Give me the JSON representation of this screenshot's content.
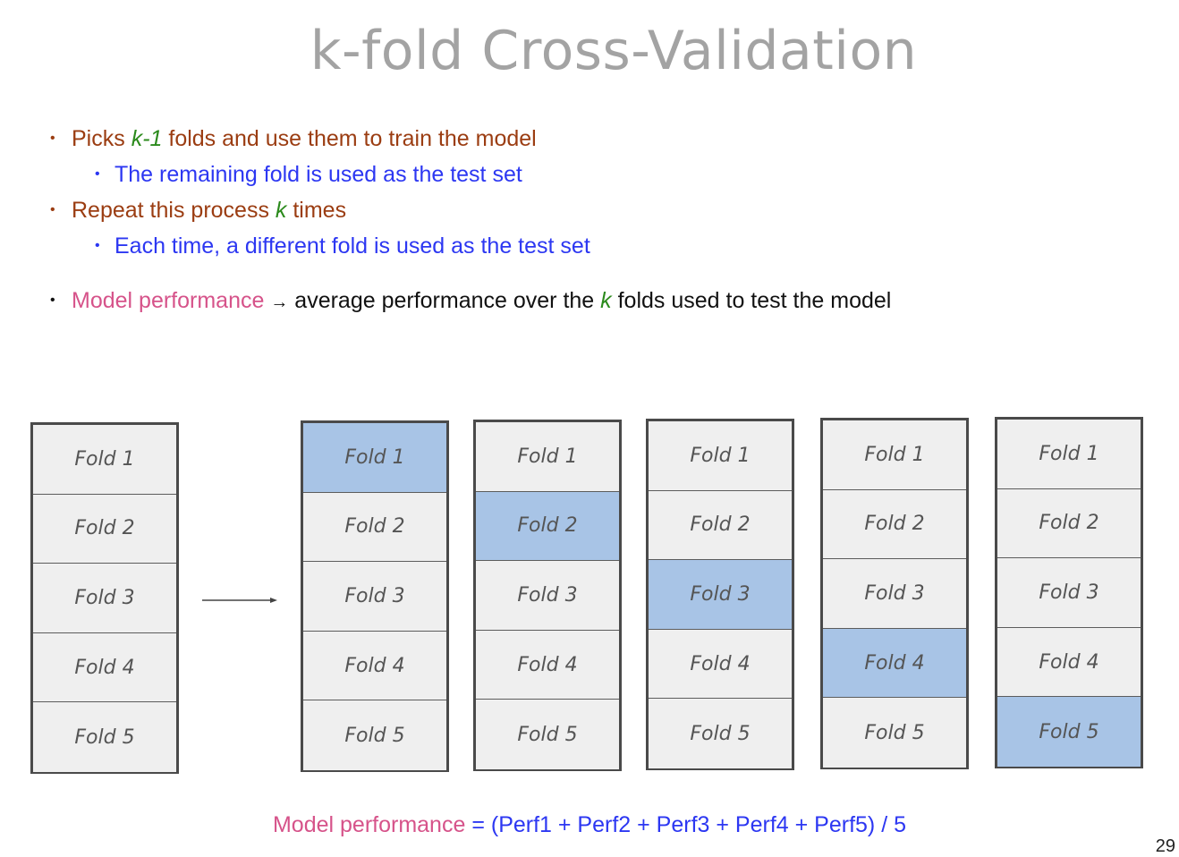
{
  "title": "k-fold Cross-Validation",
  "bullets": {
    "b1": {
      "pre": "Picks ",
      "k": "k-1",
      "post": " folds and use them to train the model"
    },
    "b1a": "The remaining fold is used as the test set",
    "b2": {
      "pre": "Repeat this process ",
      "k": "k",
      "post": " times"
    },
    "b2a": "Each time, a different fold is used as the test set",
    "b3": {
      "term": "Model performance",
      "arrow": "→",
      "pre": " average performance over the ",
      "k": "k",
      "post": " folds used to test the model"
    }
  },
  "folds": [
    "Fold 1",
    "Fold 2",
    "Fold 3",
    "Fold 4",
    "Fold 5"
  ],
  "iterations_test_fold": [
    1,
    2,
    3,
    4,
    5
  ],
  "formula": {
    "term": "Model performance",
    "rest": " = (Perf1 + Perf2 + Perf3 + Perf4 + Perf5) / 5"
  },
  "page_number": "29",
  "colors": {
    "title": "#a3a3a3",
    "level1": "#9b3d12",
    "level2": "#2c37f2",
    "k_var": "#2b8a1c",
    "term": "#d6538a",
    "test_fold": "#a8c4e6",
    "train_fold": "#efefef"
  }
}
